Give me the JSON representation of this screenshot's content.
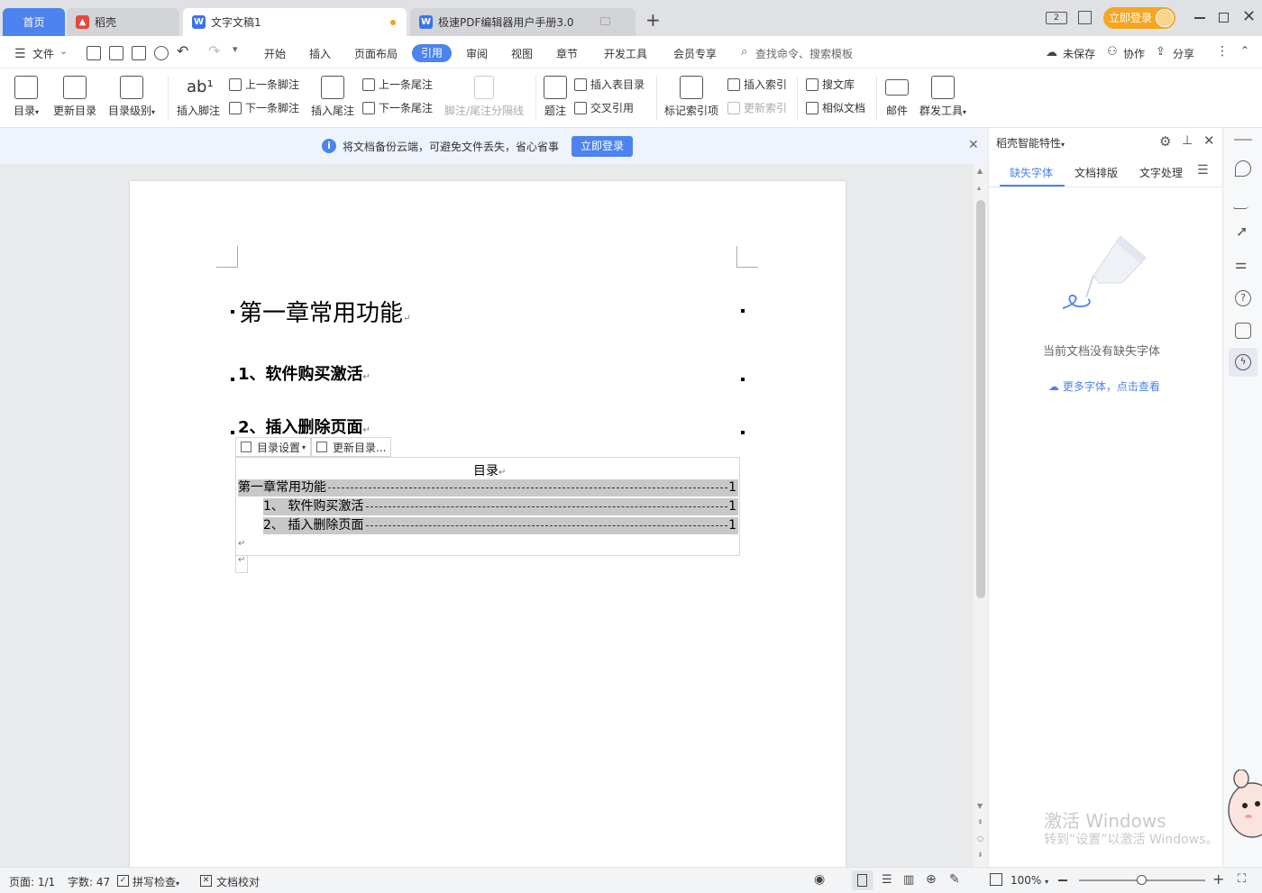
{
  "tabs": {
    "home": "首页",
    "daoke": "稻壳",
    "doc1": "文字文稿1",
    "pdf": "极速PDF编辑器用户手册3.0",
    "login": "立即登录"
  },
  "menu": {
    "file": "文件",
    "items": [
      "开始",
      "插入",
      "页面布局",
      "引用",
      "审阅",
      "视图",
      "章节",
      "开发工具",
      "会员专享"
    ],
    "search": "查找命令、搜索模板",
    "unsaved": "未保存",
    "collab": "协作",
    "share": "分享"
  },
  "ribbon": {
    "toc": "目录",
    "update_toc": "更新目录",
    "toc_level": "目录级别",
    "insert_footnote": "插入脚注",
    "prev_footnote": "上一条脚注",
    "next_footnote": "下一条脚注",
    "insert_endnote": "插入尾注",
    "prev_endnote": "上一条尾注",
    "next_endnote": "下一条尾注",
    "footnote_sep": "脚注/尾注分隔线",
    "caption": "题注",
    "insert_table_toc": "插入表目录",
    "cross_ref": "交叉引用",
    "mark_index": "标记索引项",
    "insert_index": "插入索引",
    "update_index": "更新索引",
    "search_lib": "搜文库",
    "similar_doc": "相似文档",
    "mail": "邮件",
    "group_tools": "群发工具"
  },
  "notice": {
    "text": "将文档备份云端，可避免文件丢失，省心省事",
    "login": "立即登录"
  },
  "document": {
    "h1": "第一章常用功能",
    "h2a": "1、软件购买激活",
    "h2b": "2、插入删除页面",
    "toc_settings": "目录设置",
    "toc_update": "更新目录...",
    "toc_title": "目录",
    "toc_entries": [
      {
        "text": "第一章常用功能",
        "page": "1"
      },
      {
        "text": "1、 软件购买激活",
        "page": "1"
      },
      {
        "text": "2、 插入删除页面",
        "page": "1"
      }
    ]
  },
  "panel": {
    "title": "稻壳智能特性",
    "tabs": [
      "缺失字体",
      "文档排版",
      "文字处理"
    ],
    "empty_text": "当前文档没有缺失字体",
    "more_link": "更多字体，点击查看"
  },
  "status": {
    "page": "页面: 1/1",
    "words": "字数: 47",
    "spell": "拼写检查",
    "proof": "文档校对",
    "zoom": "100%"
  },
  "watermark": {
    "line1": "激活 Windows",
    "line2": "转到“设置”以激活 Windows。"
  }
}
